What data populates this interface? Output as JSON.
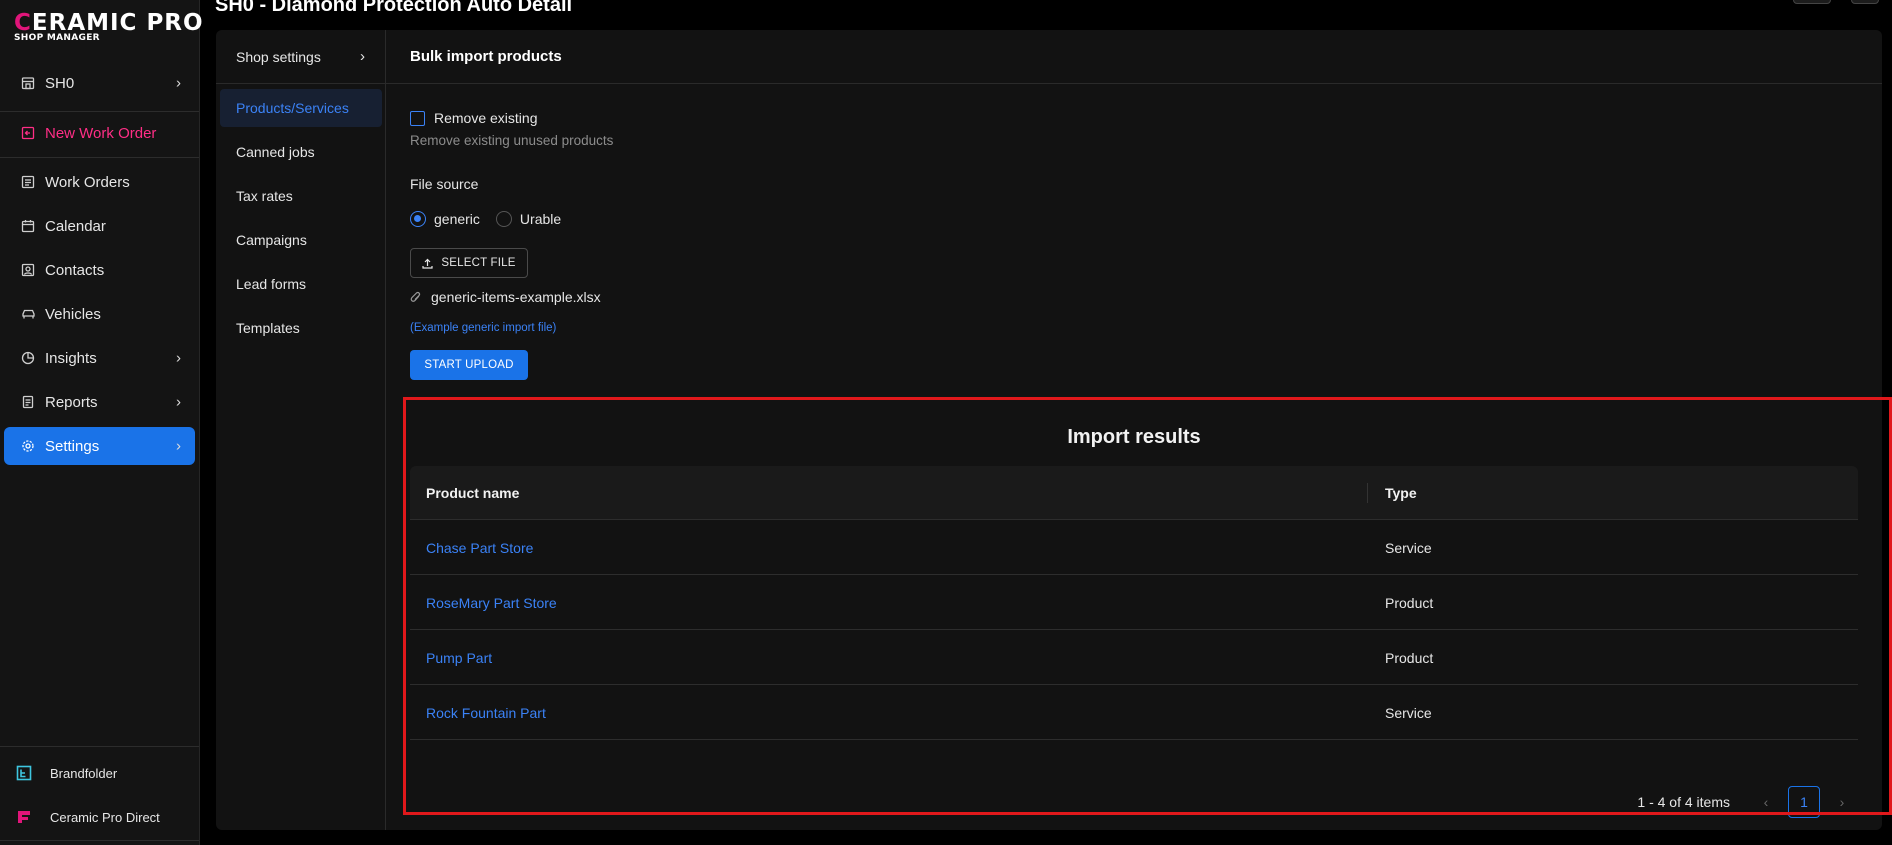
{
  "logo": {
    "brand_main": "Ceramic Pro",
    "brand_sub": "SHOP MANAGER"
  },
  "page_title": "SH0 - Diamond Protection Auto Detail",
  "nav": {
    "items": [
      {
        "label": "SH0",
        "icon": "store-icon"
      },
      {
        "label": "New Work Order",
        "icon": "new-order-icon"
      },
      {
        "label": "Work Orders",
        "icon": "work-orders-icon"
      },
      {
        "label": "Calendar",
        "icon": "calendar-icon"
      },
      {
        "label": "Contacts",
        "icon": "contacts-icon"
      },
      {
        "label": "Vehicles",
        "icon": "car-icon"
      },
      {
        "label": "Insights",
        "icon": "pie-chart-icon"
      },
      {
        "label": "Reports",
        "icon": "report-icon"
      },
      {
        "label": "Settings",
        "icon": "gear-icon"
      }
    ],
    "bottom_links": [
      {
        "label": "Brandfolder",
        "icon": "brandfolder-icon",
        "color": "#3ec6e0"
      },
      {
        "label": "Ceramic Pro Direct",
        "icon": "ceramic-direct-icon",
        "color": "#e0157a"
      }
    ],
    "accent_color": "#1a73e8",
    "new_order_color": "#ff2e86"
  },
  "settings_menu": {
    "header": "Shop settings",
    "items": [
      "Products/Services",
      "Canned jobs",
      "Tax rates",
      "Campaigns",
      "Lead forms",
      "Templates"
    ]
  },
  "content": {
    "title": "Bulk import products",
    "remove_existing": {
      "label": "Remove existing",
      "help": "Remove existing unused products",
      "checked": false
    },
    "file_source": {
      "label": "File source",
      "options": [
        "generic",
        "Urable"
      ],
      "selected": "generic"
    },
    "select_file_label": "SELECT FILE",
    "file_name": "generic-items-example.xlsx",
    "example_link": "(Example generic import file)",
    "start_upload_label": "START UPLOAD"
  },
  "results": {
    "title": "Import results",
    "columns": [
      "Product name",
      "Type"
    ],
    "rows": [
      {
        "name": "Chase Part Store",
        "type": "Service"
      },
      {
        "name": "RoseMary Part Store",
        "type": "Product"
      },
      {
        "name": "Pump Part",
        "type": "Product"
      },
      {
        "name": "Rock Fountain Part",
        "type": "Service"
      }
    ],
    "pagination": {
      "summary": "1 - 4 of 4 items",
      "current_page": "1"
    }
  },
  "highlight_color": "#e0181b"
}
